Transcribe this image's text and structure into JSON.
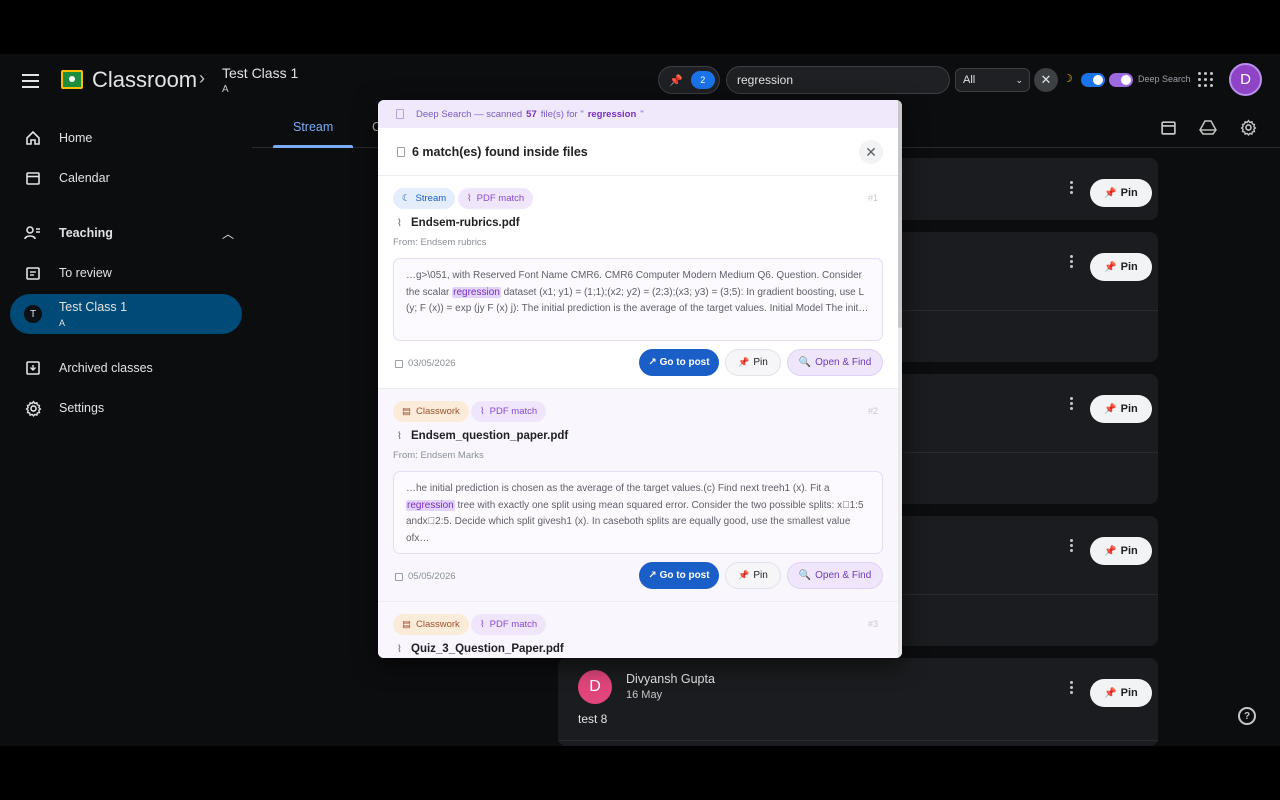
{
  "header": {
    "brand": "Classroom",
    "breadcrumb_sep": "›",
    "class_title": "Test Class 1",
    "class_sub": "A",
    "pin_count": "2",
    "search_value": "regression",
    "filter_value": "All",
    "deep_search_label": "Deep Search",
    "avatar_letter": "D"
  },
  "sidebar": {
    "home": "Home",
    "calendar": "Calendar",
    "teaching": "Teaching",
    "to_review": "To review",
    "class_name": "Test Class 1",
    "class_section": "A",
    "class_badge": "T",
    "archived": "Archived classes",
    "settings": "Settings"
  },
  "tabs": {
    "stream": "Stream",
    "second_partial": "C"
  },
  "feed": {
    "pin_label": "Pin",
    "last_post": {
      "avatar": "D",
      "author": "Divyansh Gupta",
      "date": "16 May",
      "text": "test 8"
    }
  },
  "modal": {
    "banner_prefix": "Deep Search — scanned",
    "banner_count": "57",
    "banner_mid": "file(s) for \"",
    "banner_query": "regression",
    "banner_suffix": "\"",
    "title": "6 match(es) found inside files",
    "go_label": "↗ Go to post",
    "pin_label": "Pin",
    "open_label": "Open & Find",
    "results": [
      {
        "chip_source": "Stream",
        "chip_type": "PDF match",
        "num": "#1",
        "file": "Endsem-rubrics.pdf",
        "from": "From: Endsem rubrics",
        "snip_before": "…g>\\051, with Reserved Font Name CMR6. CMR6 Computer Modern Medium Q6. Question. Consider the scalar ",
        "snip_hit": "regression",
        "snip_after": " dataset (x1; y1) = (1;1);(x2; y2) = (2;3);(x3; y3) = (3;5): In gradient boosting, use L (y; F (x)) = exp (jy F (x) j): The initial prediction is the average of the target values. Initial Model The init…",
        "date": "03/05/2026"
      },
      {
        "chip_source": "Classwork",
        "chip_type": "PDF match",
        "num": "#2",
        "file": "Endsem_question_paper.pdf",
        "from": "From: Endsem Marks",
        "snip_before": "…he initial prediction is chosen as the average of the target values.(c) Find next treeh1 (x). Fit a ",
        "snip_hit": "regression",
        "snip_after": " tree with exactly one split using mean squared error. Consider the two possible splits: x􀀀1:5 andx􀀀2:5. Decide which split givesh1 (x). In caseboth splits are equally good, use the smallest value ofx…",
        "date": "05/05/2026"
      },
      {
        "chip_source": "Classwork",
        "chip_type": "PDF match",
        "num": "#3",
        "file": "Quiz_3_Question_Paper.pdf"
      }
    ]
  }
}
